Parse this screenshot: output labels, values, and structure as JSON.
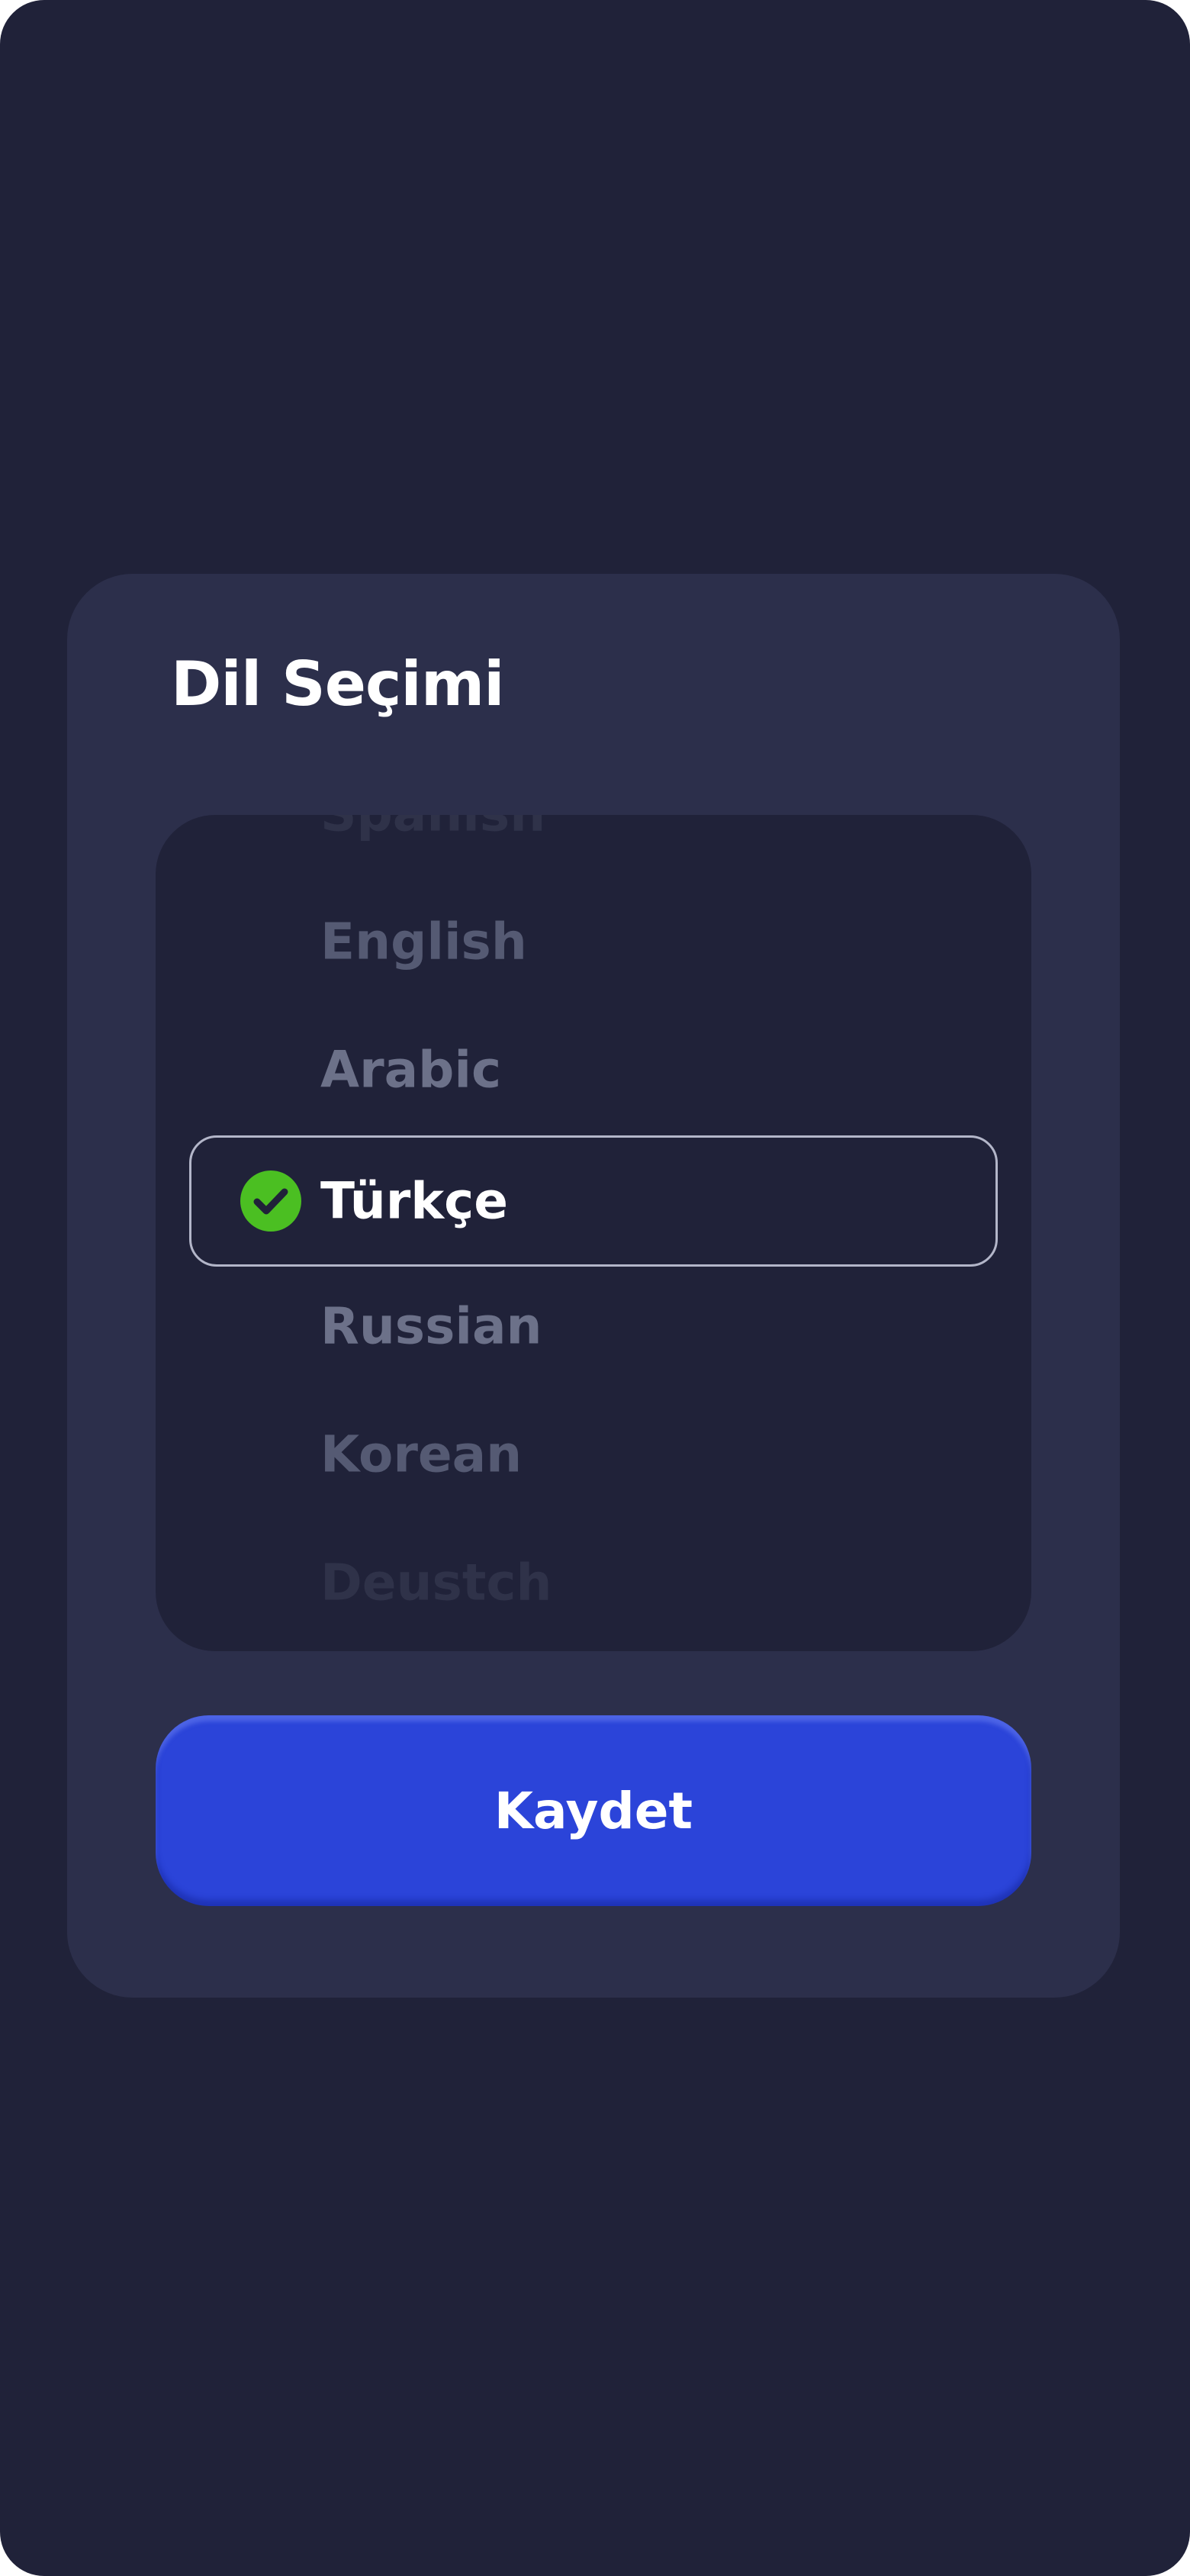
{
  "dialog": {
    "title": "Dil Seçimi",
    "language_options": [
      {
        "label": "Spanish",
        "selected": false
      },
      {
        "label": "English",
        "selected": false
      },
      {
        "label": "Arabic",
        "selected": false
      },
      {
        "label": "Türkçe",
        "selected": true
      },
      {
        "label": "Russian",
        "selected": false
      },
      {
        "label": "Korean",
        "selected": false
      },
      {
        "label": "Deustch",
        "selected": false
      }
    ],
    "selected_icon": "check-circle-icon",
    "save_button_label": "Kaydet"
  },
  "colors": {
    "background": "#202239",
    "dialog": "#2c2f4b",
    "picker": "#202239",
    "accent": "#2b44d9",
    "check": "#4bbf22",
    "selected_border": "#b3b6c9"
  }
}
